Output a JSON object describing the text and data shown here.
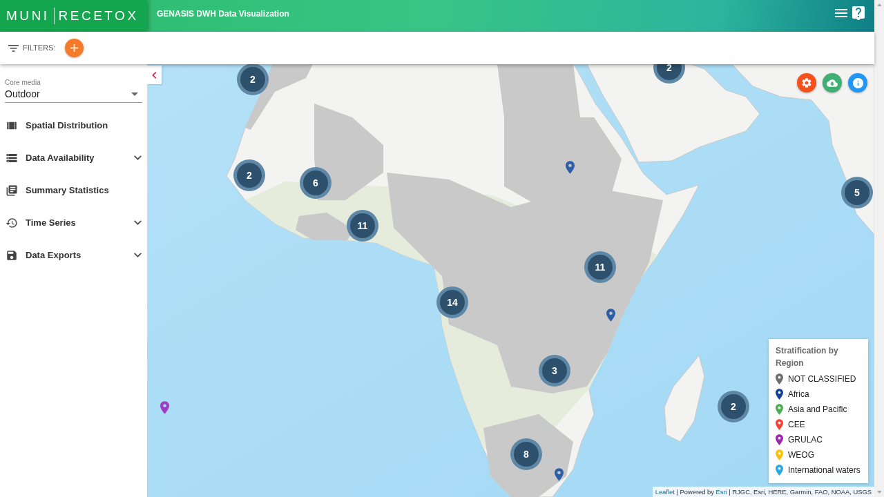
{
  "header": {
    "logo": {
      "left": "MUNI",
      "right": "RECETOX"
    },
    "title": "GENASIS DWH Data Visualization"
  },
  "filter_bar": {
    "label": "FILTERS:"
  },
  "sidebar": {
    "core_media": {
      "label": "Core media",
      "value": "Outdoor"
    },
    "items": [
      {
        "label": "Spatial Distribution",
        "expandable": false
      },
      {
        "label": "Data Availability",
        "expandable": true
      },
      {
        "label": "Summary Statistics",
        "expandable": false
      },
      {
        "label": "Time Series",
        "expandable": true
      },
      {
        "label": "Data Exports",
        "expandable": true
      }
    ]
  },
  "map": {
    "clusters": [
      {
        "count": "2"
      },
      {
        "count": "2"
      },
      {
        "count": "2"
      },
      {
        "count": "6"
      },
      {
        "count": "5"
      },
      {
        "count": "11"
      },
      {
        "count": "11"
      },
      {
        "count": "14"
      },
      {
        "count": "3"
      },
      {
        "count": "2"
      },
      {
        "count": "8"
      }
    ],
    "pins": [
      {
        "color": "#2f5ea8"
      },
      {
        "color": "#2f5ea8"
      },
      {
        "color": "#9c3fc2"
      },
      {
        "color": "#2f5ea8"
      }
    ]
  },
  "legend": {
    "title": "Stratification by Region",
    "items": [
      {
        "label": "NOT CLASSIFIED",
        "color": "#6e6e6e"
      },
      {
        "label": "Africa",
        "color": "#153f96"
      },
      {
        "label": "Asia and Pacific",
        "color": "#4caf50"
      },
      {
        "label": "CEE",
        "color": "#f44336"
      },
      {
        "label": "GRULAC",
        "color": "#9c27b0"
      },
      {
        "label": "WEOG",
        "color": "#ffc107"
      },
      {
        "label": "International waters",
        "color": "#29a8e8"
      }
    ]
  },
  "attribution": {
    "parts": [
      {
        "text": "Leaflet",
        "link": true
      },
      {
        "text": " | Powered by ",
        "link": false
      },
      {
        "text": "Esri",
        "link": true
      },
      {
        "text": " | RJGC, Esri, HERE, Garmin, FAO, NOAA, USGS",
        "link": false
      }
    ]
  }
}
